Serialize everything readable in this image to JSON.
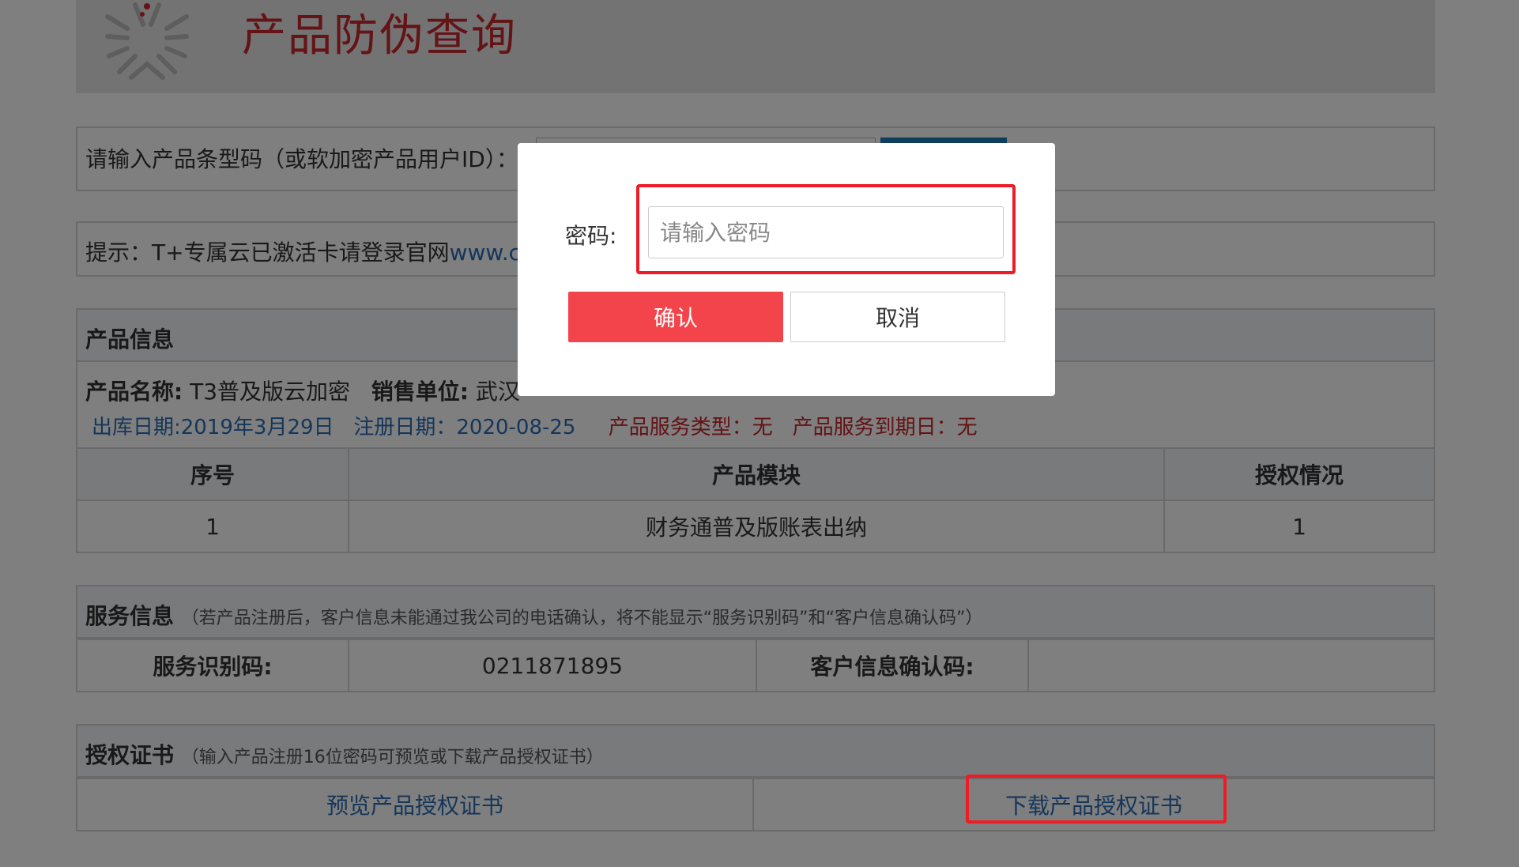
{
  "header": {
    "title": "产品防伪查询"
  },
  "search": {
    "label": "请输入产品条型码（或软加密产品用户ID）："
  },
  "hint": {
    "prefix": "提示：T+专属云已激活卡请登录官网",
    "link": "www.cl"
  },
  "product": {
    "section_title": "产品信息",
    "name_label": "产品名称:",
    "name_value": "T3普及版云加密",
    "seller_label": "销售单位:",
    "seller_value": "武汉",
    "ship_date": "出库日期:2019年3月29日",
    "reg_date": "注册日期：2020-08-25",
    "service_type": "产品服务类型：无",
    "service_expire": "产品服务到期日：无",
    "table_headers": [
      "序号",
      "产品模块",
      "授权情况"
    ],
    "rows": [
      [
        "1",
        "财务通普及版账表出纳",
        "1"
      ]
    ]
  },
  "service": {
    "section_title": "服务信息",
    "note": "（若产品注册后，客户信息未能通过我公司的电话确认，将不能显示“服务识别码”和“客户信息确认码”）",
    "id_label": "服务识别码:",
    "id_value": "0211871895",
    "confirm_label": "客户信息确认码:",
    "confirm_value": ""
  },
  "cert": {
    "section_title": "授权证书",
    "note": "（输入产品注册16位密码可预览或下载产品授权证书）",
    "preview_link": "预览产品授权证书",
    "download_link": "下载产品授权证书"
  },
  "modal": {
    "password_label": "密码:",
    "password_placeholder": "请输入密码",
    "confirm_label": "确认",
    "cancel_label": "取消"
  },
  "colors": {
    "title_red": "#c9262c",
    "link_blue": "#2a6db5",
    "confirm_red": "#f2444a",
    "highlight_red": "#ee1c24"
  }
}
